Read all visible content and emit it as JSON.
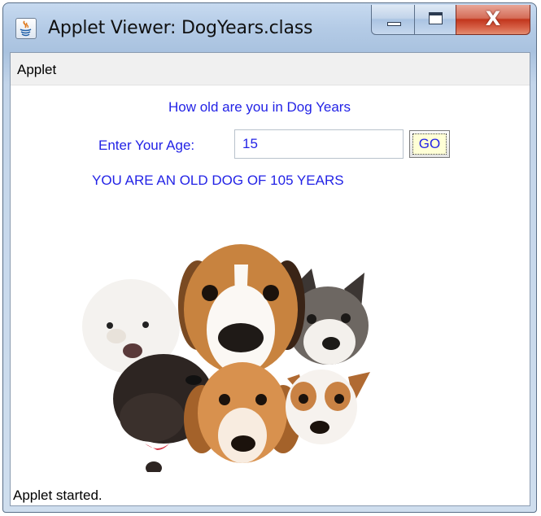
{
  "window": {
    "title": "Applet Viewer: DogYears.class",
    "controls": {
      "minimize": "minimize",
      "maximize": "maximize",
      "close": "X"
    }
  },
  "menubar": {
    "items": [
      "Applet"
    ]
  },
  "applet": {
    "heading": "How old are you in Dog Years",
    "age_label": "Enter Your Age:",
    "age_value": "15",
    "go_label": "GO",
    "result": "YOU ARE AN OLD DOG OF 105 YEARS",
    "image_icon": "dogs-photo"
  },
  "status": {
    "text": "Applet started."
  },
  "colors": {
    "applet_text": "#2323e6",
    "titlebar": "#b4cbe6",
    "close_button": "#c2351c"
  }
}
